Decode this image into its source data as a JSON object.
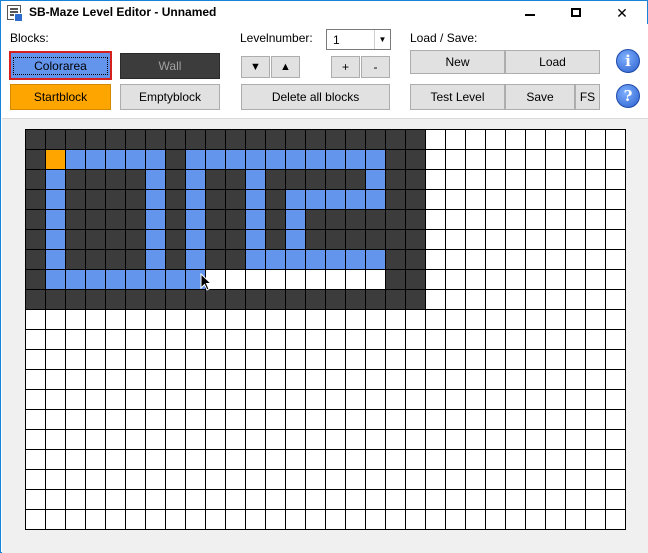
{
  "window": {
    "title": "SB-Maze Level Editor - Unnamed",
    "controls": {
      "minimize": "minimize-icon",
      "maximize": "maximize-icon",
      "close": "✕"
    }
  },
  "blocks": {
    "label": "Blocks:",
    "colorarea": "Colorarea",
    "wall": "Wall",
    "startblock": "Startblock",
    "emptyblock": "Emptyblock",
    "selected": "Colorarea"
  },
  "level": {
    "label": "Levelnumber:",
    "value": "1",
    "down_icon": "▼",
    "up_icon": "▲",
    "plus": "+",
    "minus": "-",
    "delete_all": "Delete all blocks"
  },
  "loadsave": {
    "label": "Load / Save:",
    "new": "New",
    "load": "Load",
    "test_level": "Test Level",
    "save": "Save",
    "fs": "FS",
    "info_icon": "i",
    "help_icon": "?"
  },
  "colors": {
    "wall": "#3c3c3c",
    "color": "#6495ed",
    "start": "#ffa500",
    "empty": "#ffffff"
  },
  "grid": {
    "cols": 30,
    "rows": 20,
    "legend": {
      ".": "empty",
      "W": "wall",
      "C": "color",
      "S": "start"
    },
    "rows_data": [
      "WWWWWWWWWWWWWWWWWWWW..........",
      "WSCCCCCWCCCCCCCCCCWW..........",
      "WCWWWWCWCWWCWWWWWCWW..........",
      "WCWWWWCWCWWCWCCCCCWW..........",
      "WCWWWWCWCWWCWCWWWWWW..........",
      "WCWWWWCWCWWCWCWWWWWW..........",
      "WCWWWWCWCWWCCCCCCCWW..........",
      "WCCCCCCCC.........WW..........",
      "WWWWWWWWWWWWWWWWWWWW..........",
      "..............................",
      "..............................",
      "..............................",
      "..............................",
      "..............................",
      "..............................",
      "..............................",
      "..............................",
      "..............................",
      "..............................",
      ".............................."
    ]
  }
}
